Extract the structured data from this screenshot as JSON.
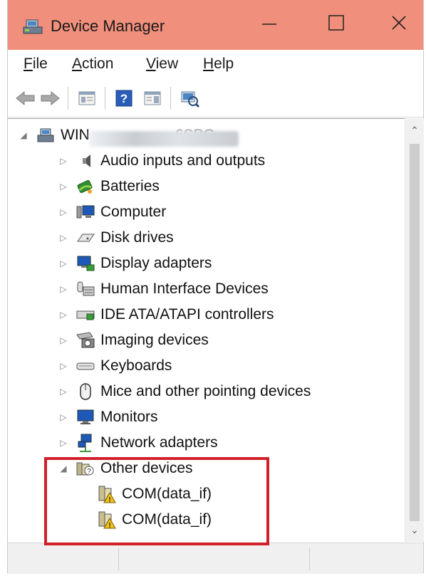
{
  "window": {
    "title": "Device Manager",
    "accent_color": "#f08f7b"
  },
  "menubar": {
    "items": [
      {
        "label": "File",
        "mnemonic": "F",
        "rest": "ile"
      },
      {
        "label": "Action",
        "mnemonic": "A",
        "rest": "ction"
      },
      {
        "label": "View",
        "mnemonic": "V",
        "rest": "iew"
      },
      {
        "label": "Help",
        "mnemonic": "H",
        "rest": "elp"
      }
    ]
  },
  "toolbar": {
    "buttons": [
      "back-icon",
      "forward-icon",
      "properties-icon",
      "help-icon",
      "show-hide-icon",
      "scan-hardware-icon"
    ]
  },
  "tree": {
    "root": {
      "label": "WIN",
      "label_tail": "6SPG",
      "expanded": true
    },
    "categories": [
      {
        "label": "Audio inputs and outputs",
        "icon": "speaker-icon",
        "expanded": false
      },
      {
        "label": "Batteries",
        "icon": "battery-icon",
        "expanded": false
      },
      {
        "label": "Computer",
        "icon": "computer-icon",
        "expanded": false
      },
      {
        "label": "Disk drives",
        "icon": "disk-drive-icon",
        "expanded": false
      },
      {
        "label": "Display adapters",
        "icon": "display-adapter-icon",
        "expanded": false
      },
      {
        "label": "Human Interface Devices",
        "icon": "hid-icon",
        "expanded": false
      },
      {
        "label": "IDE ATA/ATAPI controllers",
        "icon": "ide-controller-icon",
        "expanded": false
      },
      {
        "label": "Imaging devices",
        "icon": "camera-icon",
        "expanded": false
      },
      {
        "label": "Keyboards",
        "icon": "keyboard-icon",
        "expanded": false
      },
      {
        "label": "Mice and other pointing devices",
        "icon": "mouse-icon",
        "expanded": false
      },
      {
        "label": "Monitors",
        "icon": "monitor-icon",
        "expanded": false
      },
      {
        "label": "Network adapters",
        "icon": "network-adapter-icon",
        "expanded": false
      },
      {
        "label": "Other devices",
        "icon": "unknown-device-icon",
        "expanded": true
      }
    ],
    "other_devices_children": [
      {
        "label": "COM(data_if)",
        "icon": "warning-device-icon"
      },
      {
        "label": "COM(data_if)",
        "icon": "warning-device-icon"
      }
    ]
  },
  "highlight_color": "#d1202a"
}
